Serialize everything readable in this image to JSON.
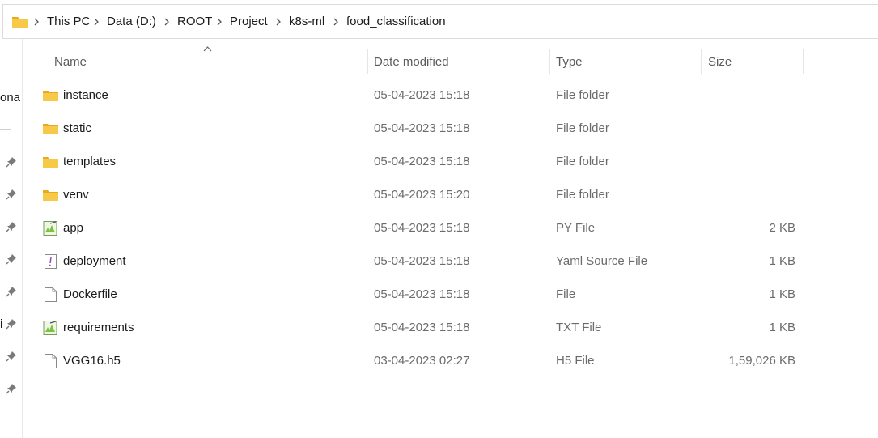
{
  "breadcrumb": {
    "items": [
      "This PC",
      "Data (D:)",
      "ROOT",
      "Project",
      "k8s-ml",
      "food_classification"
    ]
  },
  "nav_pane": {
    "fragments": [
      "ona",
      "i"
    ]
  },
  "columns": {
    "name": "Name",
    "date_modified": "Date modified",
    "type": "Type",
    "size": "Size"
  },
  "files": [
    {
      "name": "instance",
      "date": "05-04-2023 15:18",
      "type": "File folder",
      "size": "",
      "icon": "folder-icon"
    },
    {
      "name": "static",
      "date": "05-04-2023 15:18",
      "type": "File folder",
      "size": "",
      "icon": "folder-icon"
    },
    {
      "name": "templates",
      "date": "05-04-2023 15:18",
      "type": "File folder",
      "size": "",
      "icon": "folder-icon"
    },
    {
      "name": "venv",
      "date": "05-04-2023 15:20",
      "type": "File folder",
      "size": "",
      "icon": "folder-icon"
    },
    {
      "name": "app",
      "date": "05-04-2023 15:18",
      "type": "PY File",
      "size": "2 KB",
      "icon": "notepadpp-file-icon"
    },
    {
      "name": "deployment",
      "date": "05-04-2023 15:18",
      "type": "Yaml Source File",
      "size": "1 KB",
      "icon": "yaml-file-icon"
    },
    {
      "name": "Dockerfile",
      "date": "05-04-2023 15:18",
      "type": "File",
      "size": "1 KB",
      "icon": "blank-file-icon"
    },
    {
      "name": "requirements",
      "date": "05-04-2023 15:18",
      "type": "TXT File",
      "size": "1 KB",
      "icon": "notepadpp-file-icon"
    },
    {
      "name": "VGG16.h5",
      "date": "03-04-2023 02:27",
      "type": "H5 File",
      "size": "1,59,026 KB",
      "icon": "blank-file-icon"
    }
  ],
  "colors": {
    "folder": "#f4c33d",
    "text": "#1b1b1b",
    "muted": "#6b6b6b"
  }
}
